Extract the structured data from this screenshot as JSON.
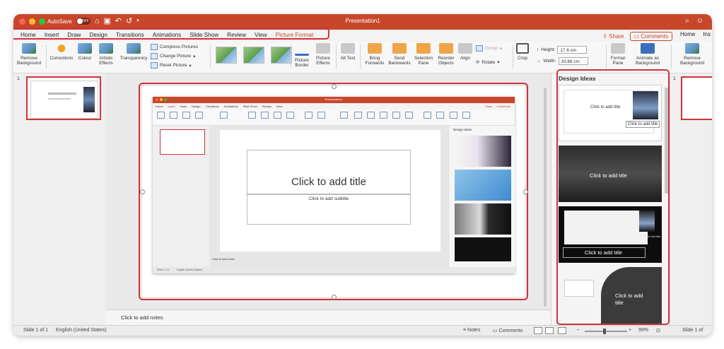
{
  "window": {
    "title": "Presentation1",
    "autosave_label": "AutoSave",
    "autosave_state": "OFF",
    "traffic_colors": [
      "#ff5f57",
      "#febc2e",
      "#28c840"
    ]
  },
  "menu": {
    "tabs": [
      "Home",
      "Insert",
      "Draw",
      "Design",
      "Transitions",
      "Animations",
      "Slide Show",
      "Review",
      "View",
      "Picture Format"
    ],
    "active_tab": "Picture Format",
    "share_label": "Share",
    "comments_label": "Comments",
    "right_tabs": [
      "Home",
      "Ins"
    ]
  },
  "ribbon": {
    "remove_background": "Remove Background",
    "corrections": "Corrections",
    "colour": "Colour",
    "artistic_effects": "Artistic Effects",
    "transparency": "Transparency",
    "compress_pictures": "Compress Pictures",
    "change_picture": "Change Picture",
    "reset_picture": "Reset Picture",
    "picture_border": "Picture Border",
    "picture_effects": "Picture Effects",
    "alt_text": "Alt Text",
    "bring_forwards": "Bring Forwards",
    "send_backwards": "Send Backwards",
    "selection_pane": "Selection Pane",
    "reorder_objects": "Reorder Objects",
    "align": "Align",
    "group": "Group",
    "rotate": "Rotate",
    "crop": "Crop",
    "height_label": "Height:",
    "height_value": "17.6 cm",
    "width_label": "Width:",
    "width_value": "33.86 cm",
    "format_pane": "Format Pane",
    "animate_as_background": "Animate as Background",
    "remove_background_right": "Remove Background"
  },
  "thumbs": {
    "slide_number": "1"
  },
  "slide": {
    "inner_window_title": "Presentation1",
    "inner_tabs": [
      "Home",
      "Insert",
      "Draw",
      "Design",
      "Transitions",
      "Animations",
      "Slide Show",
      "Review",
      "View"
    ],
    "title_placeholder": "Click to add title",
    "subtitle_placeholder": "Click to add subtitle",
    "inner_notes": "Click to add notes",
    "inner_design_header": "Design Ideas",
    "inner_status_left": "Slide 1 of 1",
    "inner_status_lang": "English (United States)",
    "inner_share": "Share",
    "inner_comments": "Comments"
  },
  "notes": {
    "placeholder": "Click to add notes"
  },
  "design_ideas": {
    "header": "Design Ideas",
    "cards": [
      {
        "title": "Click to add title",
        "subtitle": "Click to add title"
      },
      {
        "title": "Click to add title"
      },
      {
        "title": "Click to add title",
        "subtitle": "Click to add title"
      },
      {
        "title": "Click to add title"
      }
    ]
  },
  "right_pane": {
    "slide_number": "1"
  },
  "status": {
    "slide_info": "Slide 1 of 1",
    "language": "English (United States)",
    "notes": "Notes",
    "comments": "Comments",
    "zoom": "99%",
    "right_slide_info": "Slide 1 of"
  }
}
